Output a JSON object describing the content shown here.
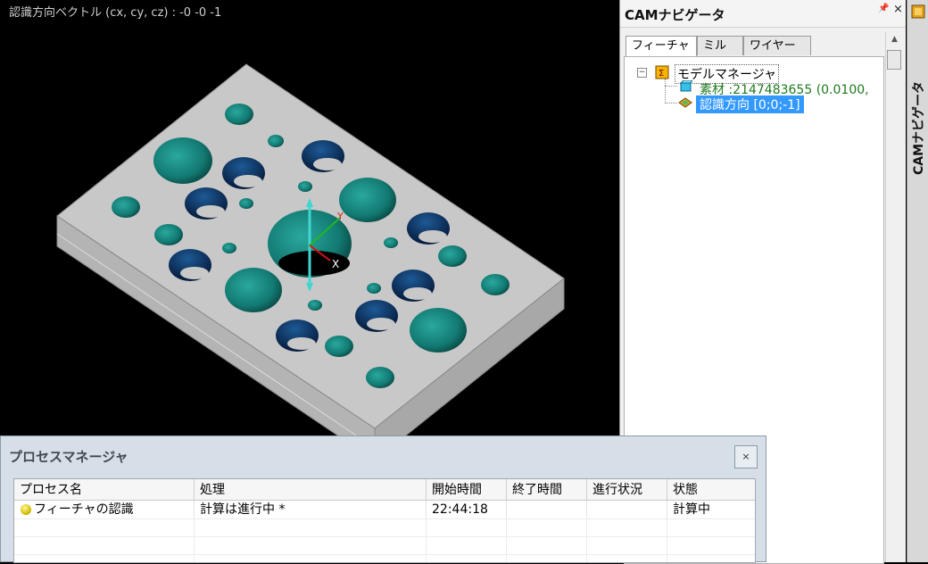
{
  "viewport": {
    "readout": "認識方向ベクトル (cx, cy, cz) : -0 -0 -1",
    "axis_x_label": "X",
    "axis_y_label": "Y"
  },
  "nav_panel": {
    "title": "CAMナビゲータ",
    "pin_glyph": "📌",
    "close_glyph": "×",
    "tabs": [
      {
        "label": "フィーチャ",
        "active": true
      },
      {
        "label": "ミル",
        "active": false
      },
      {
        "label": "ワイヤー",
        "active": false
      }
    ],
    "tree": {
      "expander": "−",
      "root_label": "モデルマネージャ",
      "children": [
        {
          "label": "素材 :2147483655 (0.0100,",
          "color": "#1f7a1f"
        },
        {
          "label": "認識方向 [0;0;-1]",
          "selected": true
        }
      ]
    }
  },
  "side_strip": {
    "label": "CAMナビゲータ"
  },
  "process_manager": {
    "title": "プロセスマネージャ",
    "close_glyph": "×",
    "columns": [
      "プロセス名",
      "処理",
      "開始時間",
      "終了時間",
      "進行状況",
      "状態"
    ],
    "rows": [
      {
        "name": "フィーチャの認識",
        "process": "計算は進行中 *",
        "start": "22:44:18",
        "end": "",
        "progress": "",
        "status": "計算中",
        "status_color": "#e0c800"
      }
    ]
  },
  "colors": {
    "viewport_bg": "#000000",
    "plate_top": "#c9c9c9",
    "hole_teal": "#1c8c84",
    "hole_dark": "#0d3a66",
    "selection": "#3399ff",
    "accent_green": "#1f7a1f"
  }
}
